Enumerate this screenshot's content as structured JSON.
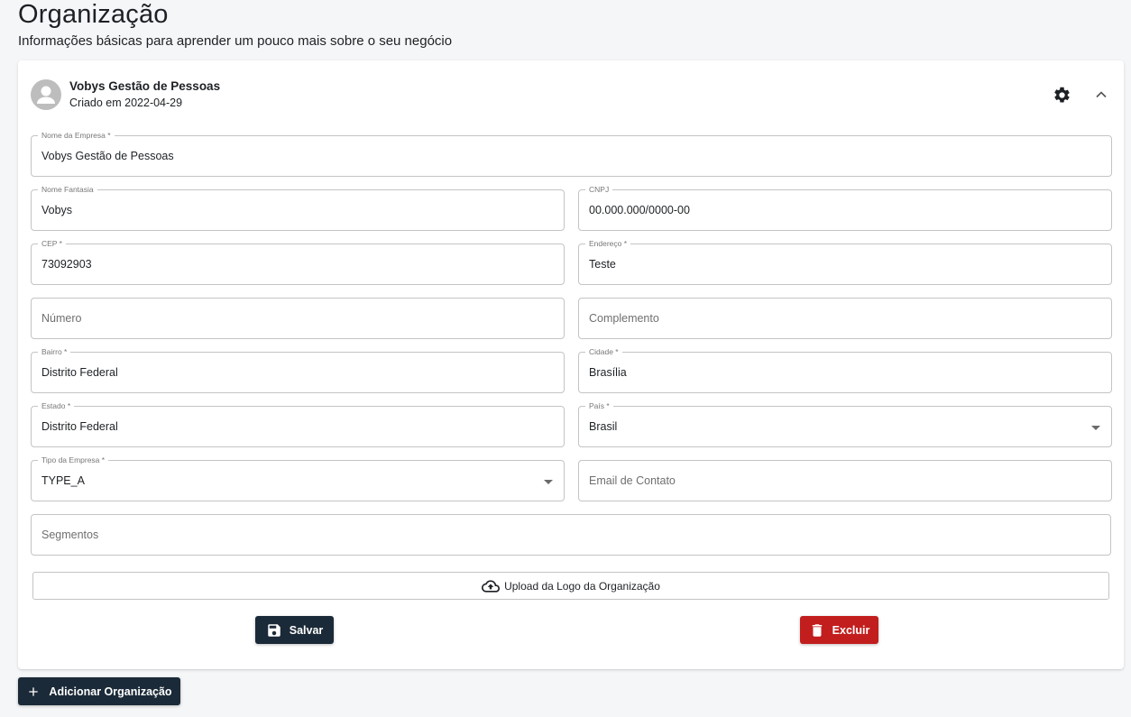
{
  "page": {
    "title": "Organização",
    "subtitle": "Informações básicas para aprender um pouco mais sobre o seu negócio"
  },
  "org": {
    "name": "Vobys Gestão de Pessoas",
    "created": "Criado em 2022-04-29"
  },
  "fields": {
    "company_name": {
      "label": "Nome da Empresa *",
      "value": "Vobys Gestão de Pessoas"
    },
    "trade_name": {
      "label": "Nome Fantasia",
      "value": "Vobys"
    },
    "cnpj": {
      "label": "CNPJ",
      "value": "00.000.000/0000-00"
    },
    "cep": {
      "label": "CEP *",
      "value": "73092903"
    },
    "address": {
      "label": "Endereço *",
      "value": "Teste"
    },
    "number": {
      "placeholder": "Número"
    },
    "complement": {
      "placeholder": "Complemento"
    },
    "district": {
      "label": "Bairro *",
      "value": "Distrito Federal"
    },
    "city": {
      "label": "Cidade *",
      "value": "Brasília"
    },
    "state": {
      "label": "Estado *",
      "value": "Distrito Federal"
    },
    "country": {
      "label": "País *",
      "value": "Brasil"
    },
    "company_type": {
      "label": "Tipo da Empresa *",
      "value": "TYPE_A"
    },
    "contact_email": {
      "placeholder": "Email de Contato"
    },
    "segments": {
      "placeholder": "Segmentos"
    }
  },
  "actions": {
    "upload_label": "Upload da Logo da Organização",
    "save_label": "Salvar",
    "delete_label": "Excluir",
    "add_label": "Adicionar Organização"
  },
  "colors": {
    "primary": "#1b2a38",
    "danger": "#c21e1e",
    "background": "#f5f6f7"
  },
  "icons": {
    "avatar": "person-icon",
    "settings": "gear-icon",
    "collapse": "chevron-up-icon",
    "upload": "cloud-upload-icon",
    "save": "floppy-disk-icon",
    "delete": "trash-icon",
    "add": "plus-icon"
  }
}
